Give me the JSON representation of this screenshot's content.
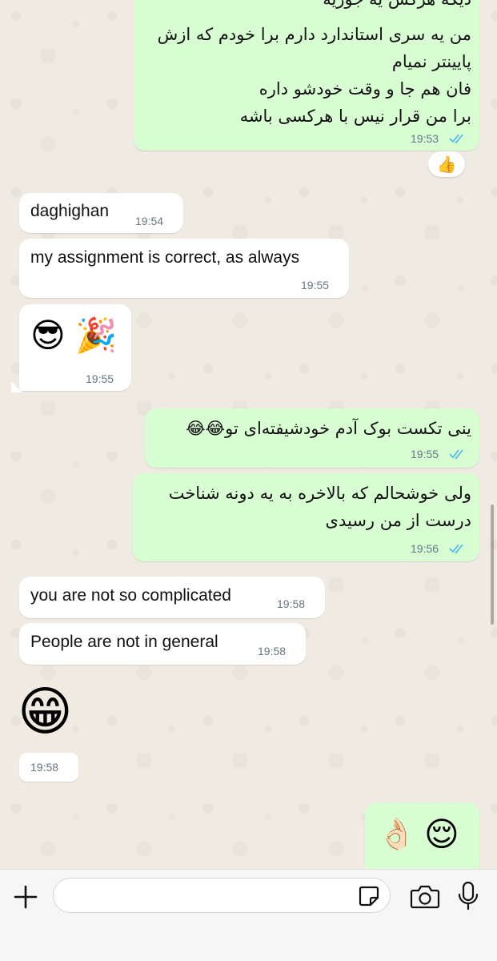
{
  "messages": [
    {
      "id": "m1",
      "direction": "outgoing",
      "lines": [
        "دیگه هرکس یه جوریه",
        "من یه سری استاندارد دارم برا خودم که ازش",
        "پایینتر نمیام",
        "فان هم جا و وقت خودشو داره",
        "برا من قرار نیس با هرکسی باشه"
      ],
      "time": "19:53",
      "status": "read",
      "reaction": "👍"
    },
    {
      "id": "m2",
      "direction": "incoming",
      "text": "daghighan",
      "time": "19:54"
    },
    {
      "id": "m3",
      "direction": "incoming",
      "text": "my assignment is correct, as always",
      "time": "19:55"
    },
    {
      "id": "m4",
      "direction": "incoming",
      "emoji": [
        "😎",
        "🎉"
      ],
      "time": "19:55"
    },
    {
      "id": "m5",
      "direction": "outgoing",
      "text": "ینی تکست بوک آدم خودشیفته‌ای تو😂😂",
      "time": "19:55",
      "status": "read"
    },
    {
      "id": "m6",
      "direction": "outgoing",
      "lines": [
        "ولی خوشحالم که بالاخره به یه دونه شناخت",
        "درست از من رسیدی"
      ],
      "time": "19:56",
      "status": "read"
    },
    {
      "id": "m7",
      "direction": "incoming",
      "text": "you are not so complicated",
      "time": "19:58"
    },
    {
      "id": "m8",
      "direction": "incoming",
      "text": "People are not in general",
      "time": "19:58"
    },
    {
      "id": "m9",
      "direction": "incoming",
      "emoji": [
        "😁"
      ],
      "time": "19:58"
    },
    {
      "id": "m10",
      "direction": "outgoing",
      "emoji": [
        "👌🏻",
        "😌"
      ]
    }
  ],
  "input_bar": {
    "message_value": "",
    "message_placeholder": "",
    "icons": [
      "plus-icon",
      "sticker-icon",
      "camera-icon",
      "microphone-icon"
    ]
  },
  "colors": {
    "outgoing_bubble": "#d9fdd3",
    "incoming_bubble": "#ffffff",
    "read_ticks": "#53bdeb",
    "wallpaper": "#efeae2"
  }
}
